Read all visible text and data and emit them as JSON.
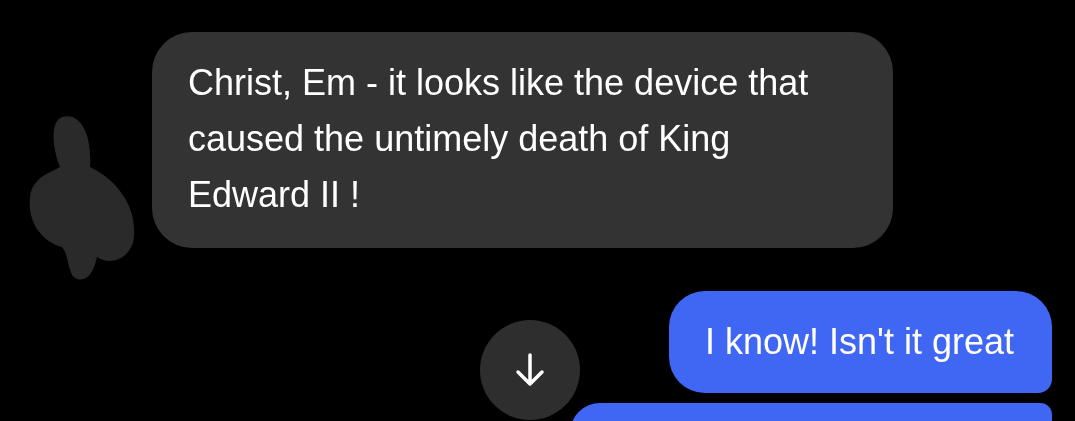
{
  "messages": [
    {
      "kind": "received",
      "text": "Christ, Em - it looks like the device that caused the untimely death of King Edward II !"
    },
    {
      "kind": "sent",
      "text": "I know! Isn't it great"
    },
    {
      "kind": "sent"
    }
  ]
}
